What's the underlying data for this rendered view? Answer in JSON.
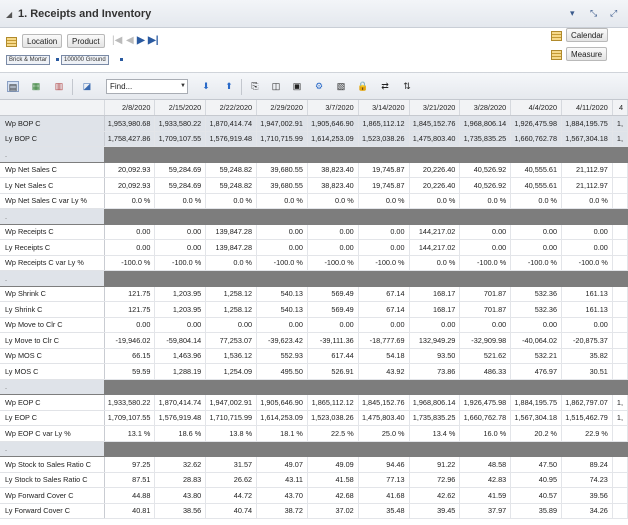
{
  "window": {
    "title": "1. Receipts and Inventory",
    "controls": [
      "▾",
      "⤡",
      "⤢"
    ]
  },
  "dimensions": {
    "left_buttons": [
      "Location",
      "Product"
    ],
    "right_buttons": [
      "Calendar",
      "Measure"
    ],
    "breadcrumbs": [
      "Brick & Mortar",
      "100000 Ground"
    ]
  },
  "toolbar": {
    "find_placeholder": "Find..."
  },
  "grid": {
    "columns": [
      "2/8/2020",
      "2/15/2020",
      "2/22/2020",
      "2/29/2020",
      "3/7/2020",
      "3/14/2020",
      "3/21/2020",
      "3/28/2020",
      "4/4/2020",
      "4/11/2020",
      "4"
    ],
    "rows": [
      {
        "label": "Wp BOP C",
        "type": "bop",
        "values": [
          "1,953,980.68",
          "1,933,580.22",
          "1,870,414.74",
          "1,947,002.91",
          "1,905,646.90",
          "1,865,112.12",
          "1,845,152.76",
          "1,968,806.14",
          "1,926,475.98",
          "1,884,195.75",
          "1,"
        ]
      },
      {
        "label": "Ly BOP C",
        "type": "bop",
        "values": [
          "1,758,427.86",
          "1,709,107.55",
          "1,576,919.48",
          "1,710,715.99",
          "1,614,253.09",
          "1,523,038.26",
          "1,475,803.40",
          "1,735,835.25",
          "1,660,762.78",
          "1,567,304.18",
          "1,"
        ]
      },
      {
        "label": ".",
        "type": "sep",
        "values": []
      },
      {
        "label": "Wp Net Sales C",
        "type": "row",
        "values": [
          "20,092.93",
          "59,284.69",
          "59,248.82",
          "39,680.55",
          "38,823.40",
          "19,745.87",
          "20,226.40",
          "40,526.92",
          "40,555.61",
          "21,112.97",
          ""
        ]
      },
      {
        "label": "Ly Net Sales C",
        "type": "row",
        "values": [
          "20,092.93",
          "59,284.69",
          "59,248.82",
          "39,680.55",
          "38,823.40",
          "19,745.87",
          "20,226.40",
          "40,526.92",
          "40,555.61",
          "21,112.97",
          ""
        ]
      },
      {
        "label": "Wp Net Sales C var Ly %",
        "type": "row",
        "values": [
          "0.0 %",
          "0.0 %",
          "0.0 %",
          "0.0 %",
          "0.0 %",
          "0.0 %",
          "0.0 %",
          "0.0 %",
          "0.0 %",
          "0.0 %",
          ""
        ]
      },
      {
        "label": ".",
        "type": "sep",
        "values": []
      },
      {
        "label": "Wp Receipts C",
        "type": "row",
        "values": [
          "0.00",
          "0.00",
          "139,847.28",
          "0.00",
          "0.00",
          "0.00",
          "144,217.02",
          "0.00",
          "0.00",
          "0.00",
          ""
        ]
      },
      {
        "label": "Ly Receipts C",
        "type": "row",
        "values": [
          "0.00",
          "0.00",
          "139,847.28",
          "0.00",
          "0.00",
          "0.00",
          "144,217.02",
          "0.00",
          "0.00",
          "0.00",
          ""
        ]
      },
      {
        "label": "Wp Receipts C var Ly %",
        "type": "row",
        "values": [
          "-100.0 %",
          "-100.0 %",
          "0.0 %",
          "-100.0 %",
          "-100.0 %",
          "-100.0 %",
          "0.0 %",
          "-100.0 %",
          "-100.0 %",
          "-100.0 %",
          ""
        ]
      },
      {
        "label": ".",
        "type": "sep",
        "values": []
      },
      {
        "label": "Wp Shrink C",
        "type": "row",
        "values": [
          "121.75",
          "1,203.95",
          "1,258.12",
          "540.13",
          "569.49",
          "67.14",
          "168.17",
          "701.87",
          "532.36",
          "161.13",
          ""
        ]
      },
      {
        "label": "Ly Shrink C",
        "type": "row",
        "values": [
          "121.75",
          "1,203.95",
          "1,258.12",
          "540.13",
          "569.49",
          "67.14",
          "168.17",
          "701.87",
          "532.36",
          "161.13",
          ""
        ]
      },
      {
        "label": "Wp Move to Clr C",
        "type": "row",
        "values": [
          "0.00",
          "0.00",
          "0.00",
          "0.00",
          "0.00",
          "0.00",
          "0.00",
          "0.00",
          "0.00",
          "0.00",
          ""
        ]
      },
      {
        "label": "Ly Move to Clr C",
        "type": "row",
        "values": [
          "-19,946.02",
          "-59,804.14",
          "77,253.07",
          "-39,623.42",
          "-39,111.36",
          "-18,777.69",
          "132,949.29",
          "-32,909.98",
          "-40,064.02",
          "-20,875.37",
          ""
        ]
      },
      {
        "label": "Wp MOS C",
        "type": "row",
        "values": [
          "66.15",
          "1,463.96",
          "1,536.12",
          "552.93",
          "617.44",
          "54.18",
          "93.50",
          "521.62",
          "532.21",
          "35.82",
          ""
        ]
      },
      {
        "label": "Ly MOS C",
        "type": "row",
        "values": [
          "59.59",
          "1,288.19",
          "1,254.09",
          "495.50",
          "526.91",
          "43.92",
          "73.86",
          "486.33",
          "476.97",
          "30.51",
          ""
        ]
      },
      {
        "label": ".",
        "type": "sep",
        "values": []
      },
      {
        "label": "Wp EOP C",
        "type": "row",
        "values": [
          "1,933,580.22",
          "1,870,414.74",
          "1,947,002.91",
          "1,905,646.90",
          "1,865,112.12",
          "1,845,152.76",
          "1,968,806.14",
          "1,926,475.98",
          "1,884,195.75",
          "1,862,797.07",
          "1,"
        ]
      },
      {
        "label": "Ly EOP C",
        "type": "row",
        "values": [
          "1,709,107.55",
          "1,576,919.48",
          "1,710,715.99",
          "1,614,253.09",
          "1,523,038.26",
          "1,475,803.40",
          "1,735,835.25",
          "1,660,762.78",
          "1,567,304.18",
          "1,515,462.79",
          "1,"
        ]
      },
      {
        "label": "Wp EOP C var Ly %",
        "type": "row",
        "values": [
          "13.1 %",
          "18.6 %",
          "13.8 %",
          "18.1 %",
          "22.5 %",
          "25.0 %",
          "13.4 %",
          "16.0 %",
          "20.2 %",
          "22.9 %",
          ""
        ]
      },
      {
        "label": ".",
        "type": "sep",
        "values": []
      },
      {
        "label": "Wp Stock to Sales Ratio C",
        "type": "row",
        "values": [
          "97.25",
          "32.62",
          "31.57",
          "49.07",
          "49.09",
          "94.46",
          "91.22",
          "48.58",
          "47.50",
          "89.24",
          ""
        ]
      },
      {
        "label": "Ly Stock to Sales Ratio C",
        "type": "row",
        "values": [
          "87.51",
          "28.83",
          "26.62",
          "43.11",
          "41.58",
          "77.13",
          "72.96",
          "42.83",
          "40.95",
          "74.23",
          ""
        ]
      },
      {
        "label": "Wp Forward Cover C",
        "type": "row",
        "values": [
          "44.88",
          "43.80",
          "44.72",
          "43.70",
          "42.68",
          "41.68",
          "42.62",
          "41.59",
          "40.57",
          "39.56",
          ""
        ]
      },
      {
        "label": "Ly Forward Cover C",
        "type": "row",
        "values": [
          "40.81",
          "38.56",
          "40.74",
          "38.72",
          "37.02",
          "35.48",
          "39.45",
          "37.97",
          "35.89",
          "34.26",
          ""
        ]
      }
    ]
  }
}
